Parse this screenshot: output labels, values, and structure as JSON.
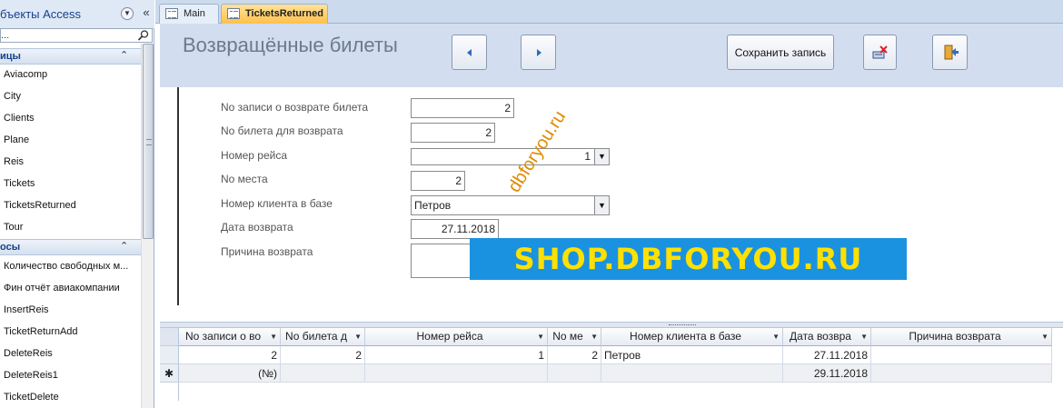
{
  "nav": {
    "title": "бъекты Access",
    "search_placeholder": "...",
    "groups": [
      {
        "label": "ицы",
        "items": [
          "Aviacomp",
          "City",
          "Clients",
          "Plane",
          "Reis",
          "Tickets",
          "TicketsReturned",
          "Tour"
        ]
      },
      {
        "label": "осы",
        "items": [
          "Количество свободных м...",
          "Фин отчёт авиакомпании",
          "InsertReis",
          "TicketReturnAdd",
          "DeleteReis",
          "DeleteReis1",
          "TicketDelete"
        ]
      }
    ]
  },
  "tabs": [
    {
      "label": "Main",
      "active": false
    },
    {
      "label": "TicketsReturned",
      "active": true
    }
  ],
  "form": {
    "title": "Возвращённые билеты",
    "buttons": {
      "prev_icon": "left-arrow",
      "next_icon": "right-arrow",
      "save_label": "Сохранить запись",
      "delete_icon": "delete-record-icon",
      "exit_icon": "exit-door-icon"
    },
    "fields": [
      {
        "label": "No записи о возврате билета",
        "value": "2"
      },
      {
        "label": "No билета для возврата",
        "value": "2"
      },
      {
        "label": "Номер рейса",
        "value": "1"
      },
      {
        "label": "No места",
        "value": "2"
      },
      {
        "label": "Номер клиента в базе",
        "value": "Петров"
      },
      {
        "label": "Дата возврата",
        "value": "27.11.2018"
      },
      {
        "label": "Причина возврата",
        "value": ""
      }
    ]
  },
  "datasheet": {
    "columns": [
      "No записи о во",
      "No билета д",
      "Номер рейса",
      "No ме",
      "Номер клиента в базе",
      "Дата возвра",
      "Причина возврата"
    ],
    "rows": [
      [
        "2",
        "2",
        "1",
        "2",
        "Петров",
        "27.11.2018",
        ""
      ],
      [
        "(№)",
        "",
        "",
        "",
        "",
        "29.11.2018",
        ""
      ]
    ],
    "new_row_marker": "✱"
  },
  "watermarks": {
    "banner": "SHOP.DBFORYOU.RU",
    "diagonal": "dbforyou.ru"
  },
  "colors": {
    "header_bg": "#d2ddef",
    "active_tab": "#ffc04a",
    "banner_bg": "#1a92e0",
    "banner_text": "#ffe000"
  }
}
